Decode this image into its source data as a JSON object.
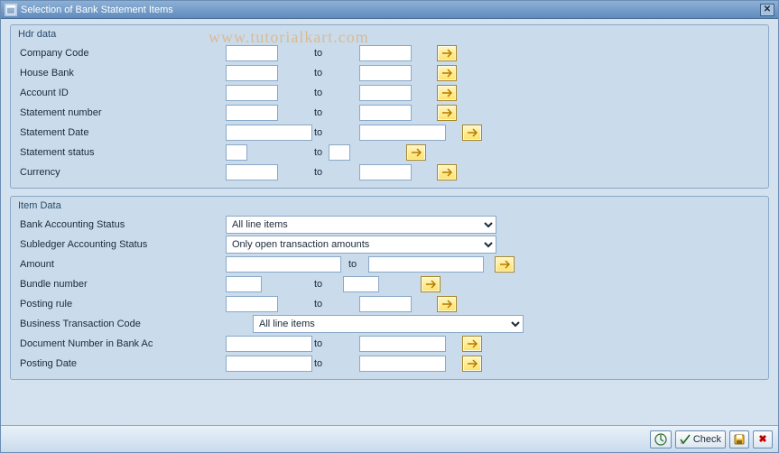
{
  "window": {
    "title": "Selection of Bank Statement Items"
  },
  "watermark": "www.tutorialkart.com",
  "common": {
    "to": "to"
  },
  "hdr": {
    "title": "Hdr data",
    "rows": {
      "company_code": {
        "label": "Company Code"
      },
      "house_bank": {
        "label": "House Bank"
      },
      "account_id": {
        "label": "Account ID"
      },
      "stmt_number": {
        "label": "Statement number"
      },
      "stmt_date": {
        "label": "Statement Date"
      },
      "stmt_status": {
        "label": "Statement status"
      },
      "currency": {
        "label": "Currency"
      }
    }
  },
  "item": {
    "title": "Item Data",
    "rows": {
      "bank_acct_status": {
        "label": "Bank Accounting Status",
        "value": "All line items"
      },
      "subledger_status": {
        "label": "Subledger Accounting Status",
        "value": "Only open transaction amounts"
      },
      "amount": {
        "label": "Amount"
      },
      "bundle_number": {
        "label": "Bundle number"
      },
      "posting_rule": {
        "label": "Posting rule"
      },
      "btc": {
        "label": "Business Transaction Code",
        "value": "All line items"
      },
      "doc_number": {
        "label": "Document Number in Bank Ac"
      },
      "posting_date": {
        "label": "Posting Date"
      }
    }
  },
  "toolbar": {
    "execute_title": "Execute",
    "check_label": "Check",
    "save_title": "Save",
    "cancel_title": "Cancel"
  }
}
